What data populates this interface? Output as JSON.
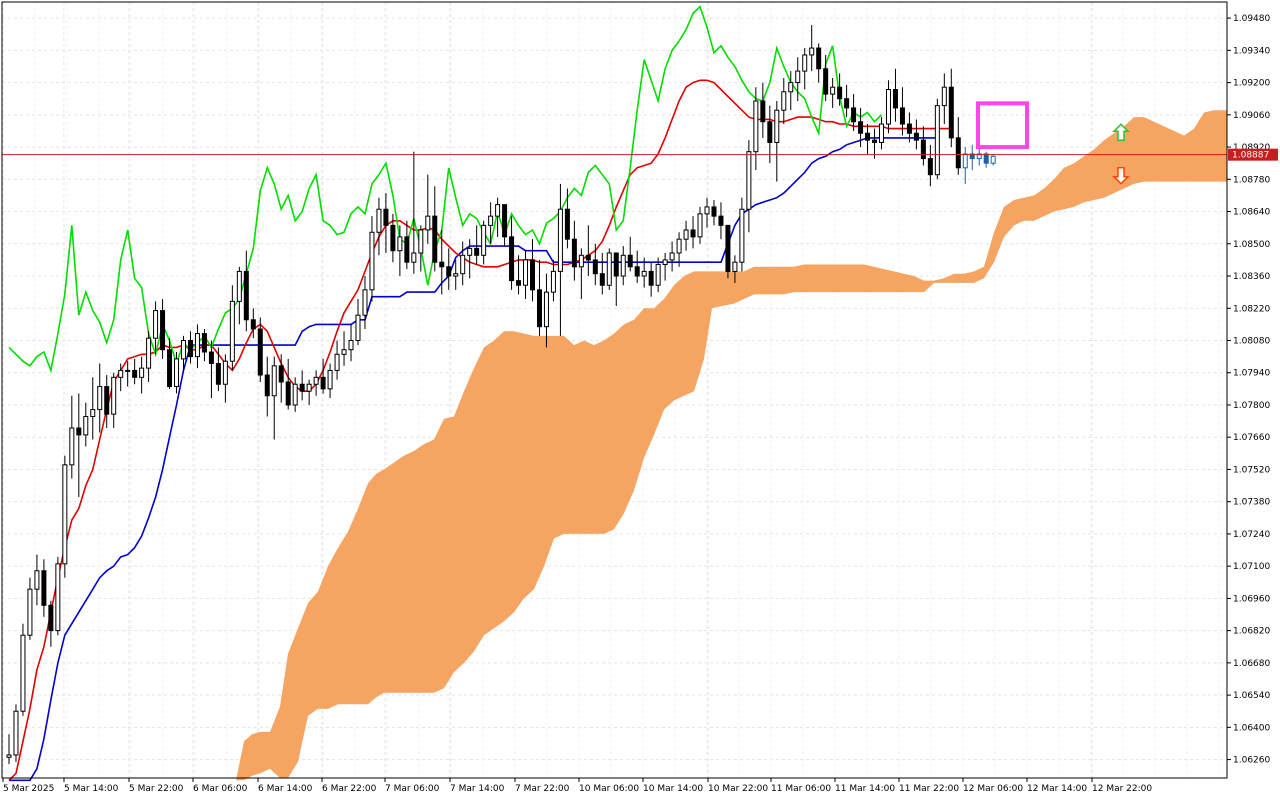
{
  "chart_data": {
    "type": "candlestick",
    "symbol_hint": "EURUSD",
    "y_ticks": [
      "1.09480",
      "1.09340",
      "1.09200",
      "1.09060",
      "1.08920",
      "1.08780",
      "1.08640",
      "1.08500",
      "1.08360",
      "1.08220",
      "1.08080",
      "1.07940",
      "1.07800",
      "1.07660",
      "1.07520",
      "1.07380",
      "1.07240",
      "1.07100",
      "1.06960",
      "1.06820",
      "1.06680",
      "1.06540",
      "1.06400",
      "1.06260"
    ],
    "ylim": [
      1.0618,
      1.0955
    ],
    "x_ticks": [
      "5 Mar 2025",
      "5 Mar 14:00",
      "5 Mar 22:00",
      "6 Mar 06:00",
      "6 Mar 14:00",
      "6 Mar 22:00",
      "7 Mar 06:00",
      "7 Mar 14:00",
      "7 Mar 22:00",
      "10 Mar 06:00",
      "10 Mar 14:00",
      "10 Mar 22:00",
      "11 Mar 06:00",
      "11 Mar 14:00",
      "11 Mar 22:00",
      "12 Mar 06:00",
      "12 Mar 14:00",
      "12 Mar 22:00"
    ],
    "current_price": "1.08887",
    "grid": true,
    "colors": {
      "tenkan": "#e00000",
      "kijun": "#0000cc",
      "chikou": "#00dd00",
      "cloud": "#f5a462",
      "price_line": "#c81e1e",
      "highlight": "#ff44ee",
      "up_arrow": "#33bb33",
      "down_arrow": "#ff4400",
      "last_candles": "#1f5fa8"
    },
    "candles": [
      [
        1.0627,
        1.0637,
        1.0624,
        1.0628
      ],
      [
        1.0628,
        1.065,
        1.0625,
        1.0647
      ],
      [
        1.0647,
        1.0685,
        1.0645,
        1.068
      ],
      [
        1.068,
        1.0705,
        1.0678,
        1.07
      ],
      [
        1.07,
        1.0715,
        1.0693,
        1.0708
      ],
      [
        1.0708,
        1.0713,
        1.0688,
        1.0693
      ],
      [
        1.0693,
        1.0695,
        1.0675,
        1.0682
      ],
      [
        1.0682,
        1.0714,
        1.068,
        1.0711
      ],
      [
        1.0711,
        1.0758,
        1.0705,
        1.0754
      ],
      [
        1.0754,
        1.0784,
        1.0748,
        1.077
      ],
      [
        1.077,
        1.0785,
        1.074,
        1.0767
      ],
      [
        1.0767,
        1.0781,
        1.0762,
        1.0775
      ],
      [
        1.0775,
        1.0792,
        1.0765,
        1.0778
      ],
      [
        1.0778,
        1.0798,
        1.0768,
        1.0788
      ],
      [
        1.0788,
        1.0793,
        1.077,
        1.0776
      ],
      [
        1.0776,
        1.0794,
        1.077,
        1.0792
      ],
      [
        1.0792,
        1.0798,
        1.0786,
        1.0795
      ],
      [
        1.0795,
        1.0799,
        1.0788,
        1.0795
      ],
      [
        1.0795,
        1.08,
        1.0789,
        1.0792
      ],
      [
        1.0792,
        1.0801,
        1.0785,
        1.0796
      ],
      [
        1.0796,
        1.0812,
        1.079,
        1.0809
      ],
      [
        1.0809,
        1.0825,
        1.0802,
        1.0821
      ],
      [
        1.0821,
        1.0826,
        1.08,
        1.0804
      ],
      [
        1.0804,
        1.0809,
        1.0787,
        1.0788
      ],
      [
        1.0788,
        1.0803,
        1.0785,
        1.08
      ],
      [
        1.08,
        1.081,
        1.0795,
        1.0808
      ],
      [
        1.0808,
        1.0812,
        1.0798,
        1.0801
      ],
      [
        1.0801,
        1.0815,
        1.0796,
        1.0811
      ],
      [
        1.0811,
        1.0813,
        1.0799,
        1.0803
      ],
      [
        1.0803,
        1.0808,
        1.0783,
        1.0798
      ],
      [
        1.0798,
        1.0805,
        1.0786,
        1.0789
      ],
      [
        1.0789,
        1.0802,
        1.0781,
        1.0799
      ],
      [
        1.0799,
        1.0832,
        1.0795,
        1.0825
      ],
      [
        1.0825,
        1.084,
        1.0815,
        1.0838
      ],
      [
        1.0838,
        1.0847,
        1.0812,
        1.0817
      ],
      [
        1.0817,
        1.0822,
        1.0809,
        1.0813
      ],
      [
        1.0813,
        1.0818,
        1.079,
        1.0793
      ],
      [
        1.0793,
        1.0801,
        1.0775,
        1.0784
      ],
      [
        1.0784,
        1.0801,
        1.0765,
        1.0797
      ],
      [
        1.0797,
        1.0802,
        1.0781,
        1.079
      ],
      [
        1.079,
        1.08,
        1.0778,
        1.078
      ],
      [
        1.078,
        1.0792,
        1.0777,
        1.0789
      ],
      [
        1.0789,
        1.0795,
        1.0782,
        1.0786
      ],
      [
        1.0786,
        1.0791,
        1.078,
        1.0789
      ],
      [
        1.0789,
        1.0795,
        1.0784,
        1.0792
      ],
      [
        1.0792,
        1.08,
        1.0785,
        1.0787
      ],
      [
        1.0787,
        1.0798,
        1.0783,
        1.0795
      ],
      [
        1.0795,
        1.0808,
        1.0791,
        1.0802
      ],
      [
        1.0802,
        1.0812,
        1.0797,
        1.0804
      ],
      [
        1.0804,
        1.0815,
        1.0799,
        1.0808
      ],
      [
        1.0808,
        1.0826,
        1.0806,
        1.0819
      ],
      [
        1.0819,
        1.0836,
        1.0813,
        1.083
      ],
      [
        1.083,
        1.0862,
        1.0825,
        1.0855
      ],
      [
        1.0855,
        1.087,
        1.0845,
        1.0865
      ],
      [
        1.0865,
        1.0872,
        1.0846,
        1.0858
      ],
      [
        1.0858,
        1.0863,
        1.0842,
        1.0847
      ],
      [
        1.0847,
        1.0858,
        1.0836,
        1.0853
      ],
      [
        1.0853,
        1.086,
        1.0839,
        1.0842
      ],
      [
        1.0842,
        1.089,
        1.0837,
        1.0846
      ],
      [
        1.0846,
        1.0858,
        1.0838,
        1.0856
      ],
      [
        1.0856,
        1.088,
        1.085,
        1.0862
      ],
      [
        1.0862,
        1.0875,
        1.0838,
        1.0842
      ],
      [
        1.0842,
        1.0856,
        1.0828,
        1.084
      ],
      [
        1.084,
        1.0848,
        1.083,
        1.0836
      ],
      [
        1.0836,
        1.0843,
        1.083,
        1.0837
      ],
      [
        1.0837,
        1.0851,
        1.0832,
        1.0845
      ],
      [
        1.0845,
        1.0852,
        1.0835,
        1.0848
      ],
      [
        1.0848,
        1.0858,
        1.0841,
        1.0845
      ],
      [
        1.0845,
        1.086,
        1.0841,
        1.0858
      ],
      [
        1.0858,
        1.0868,
        1.085,
        1.0862
      ],
      [
        1.0862,
        1.087,
        1.0853,
        1.0867
      ],
      [
        1.0867,
        1.0866,
        1.0849,
        1.0853
      ],
      [
        1.0853,
        1.0862,
        1.083,
        1.0834
      ],
      [
        1.0834,
        1.0845,
        1.0828,
        1.0832
      ],
      [
        1.0832,
        1.0847,
        1.0826,
        1.0843
      ],
      [
        1.0843,
        1.0852,
        1.0825,
        1.083
      ],
      [
        1.083,
        1.0843,
        1.081,
        1.0814
      ],
      [
        1.0814,
        1.0837,
        1.0805,
        1.0829
      ],
      [
        1.0829,
        1.0843,
        1.0825,
        1.0838
      ],
      [
        1.0838,
        1.0876,
        1.081,
        1.0865
      ],
      [
        1.0865,
        1.0874,
        1.0848,
        1.0852
      ],
      [
        1.0852,
        1.086,
        1.0834,
        1.084
      ],
      [
        1.084,
        1.0848,
        1.0826,
        1.0845
      ],
      [
        1.0845,
        1.0858,
        1.0836,
        1.0843
      ],
      [
        1.0843,
        1.085,
        1.0832,
        1.0837
      ],
      [
        1.0837,
        1.0846,
        1.0828,
        1.0832
      ],
      [
        1.0832,
        1.0848,
        1.083,
        1.0846
      ],
      [
        1.0846,
        1.0842,
        1.0823,
        1.0836
      ],
      [
        1.0836,
        1.0849,
        1.0832,
        1.0845
      ],
      [
        1.0845,
        1.0853,
        1.0838,
        1.084
      ],
      [
        1.084,
        1.0847,
        1.0833,
        1.0836
      ],
      [
        1.0836,
        1.0844,
        1.0831,
        1.0838
      ],
      [
        1.0838,
        1.0842,
        1.0827,
        1.0832
      ],
      [
        1.0832,
        1.0844,
        1.0829,
        1.0841
      ],
      [
        1.0841,
        1.0846,
        1.0834,
        1.0843
      ],
      [
        1.0843,
        1.0851,
        1.0838,
        1.0846
      ],
      [
        1.0846,
        1.0855,
        1.084,
        1.0852
      ],
      [
        1.0852,
        1.086,
        1.0847,
        1.0856
      ],
      [
        1.0856,
        1.0862,
        1.0848,
        1.0853
      ],
      [
        1.0853,
        1.0866,
        1.085,
        1.0863
      ],
      [
        1.0863,
        1.087,
        1.0857,
        1.0866
      ],
      [
        1.0866,
        1.0869,
        1.0858,
        1.0862
      ],
      [
        1.0862,
        1.0868,
        1.0852,
        1.0858
      ],
      [
        1.0858,
        1.0855,
        1.0835,
        1.0838
      ],
      [
        1.0838,
        1.0845,
        1.0833,
        1.0842
      ],
      [
        1.0842,
        1.087,
        1.0838,
        1.0865
      ],
      [
        1.0865,
        1.0895,
        1.0855,
        1.089
      ],
      [
        1.089,
        1.0918,
        1.0882,
        1.0912
      ],
      [
        1.0912,
        1.092,
        1.0896,
        1.0903
      ],
      [
        1.0903,
        1.091,
        1.0885,
        1.0894
      ],
      [
        1.0894,
        1.0912,
        1.0877,
        1.0908
      ],
      [
        1.0908,
        1.0922,
        1.0902,
        1.0916
      ],
      [
        1.0916,
        1.0925,
        1.0908,
        1.092
      ],
      [
        1.092,
        1.0931,
        1.0912,
        1.0925
      ],
      [
        1.0925,
        1.0935,
        1.0917,
        1.0932
      ],
      [
        1.0932,
        1.0945,
        1.0925,
        1.0935
      ],
      [
        1.0935,
        1.0937,
        1.092,
        1.0926
      ],
      [
        1.0926,
        1.0932,
        1.0912,
        1.0915
      ],
      [
        1.0915,
        1.0922,
        1.0909,
        1.0918
      ],
      [
        1.0918,
        1.0924,
        1.091,
        1.0913
      ],
      [
        1.0913,
        1.0919,
        1.0905,
        1.0909
      ],
      [
        1.0909,
        1.0915,
        1.0899,
        1.0903
      ],
      [
        1.0903,
        1.0909,
        1.0892,
        1.0898
      ],
      [
        1.0898,
        1.0902,
        1.0889,
        1.0895
      ],
      [
        1.0895,
        1.09,
        1.0887,
        1.0894
      ],
      [
        1.0894,
        1.0905,
        1.0891,
        1.0902
      ],
      [
        1.0902,
        1.0921,
        1.0898,
        1.0917
      ],
      [
        1.0917,
        1.0926,
        1.0903,
        1.0909
      ],
      [
        1.0909,
        1.0918,
        1.0897,
        1.0902
      ],
      [
        1.0902,
        1.0907,
        1.0894,
        1.0898
      ],
      [
        1.0898,
        1.0904,
        1.0891,
        1.0895
      ],
      [
        1.0895,
        1.0901,
        1.0884,
        1.0887
      ],
      [
        1.0887,
        1.0893,
        1.0875,
        1.088
      ],
      [
        1.088,
        1.0913,
        1.0878,
        1.091
      ],
      [
        1.091,
        1.0924,
        1.0902,
        1.0918
      ],
      [
        1.0918,
        1.0926,
        1.0892,
        1.0896
      ],
      [
        1.0896,
        1.0905,
        1.088,
        1.0883
      ],
      [
        1.0883,
        1.0892,
        1.0876,
        1.0889
      ],
      [
        1.0889,
        1.0893,
        1.0882,
        1.0887
      ],
      [
        1.0887,
        1.0893,
        1.0884,
        1.0889
      ],
      [
        1.0889,
        1.089,
        1.0883,
        1.0885
      ],
      [
        1.0885,
        1.0889,
        1.0884,
        1.0888
      ]
    ],
    "tenkan": [
      1.0617,
      1.062,
      1.0634,
      1.0648,
      1.0665,
      1.0675,
      1.069,
      1.0705,
      1.0718,
      1.073,
      1.0735,
      1.0745,
      1.0752,
      1.0765,
      1.0778,
      1.079,
      1.0795,
      1.08,
      1.0801,
      1.0802,
      1.0802,
      1.0803,
      1.0806,
      1.0805,
      1.0805,
      1.0806,
      1.0804,
      1.0804,
      1.0806,
      1.0806,
      1.0802,
      1.0798,
      1.0795,
      1.08,
      1.0807,
      1.0813,
      1.0815,
      1.0812,
      1.0805,
      1.0798,
      1.0792,
      1.0788,
      1.0786,
      1.0786,
      1.0789,
      1.0795,
      1.0803,
      1.0812,
      1.082,
      1.0825,
      1.083,
      1.0838,
      1.0846,
      1.0853,
      1.0858,
      1.086,
      1.086,
      1.0858,
      1.0856,
      1.0856,
      1.0857,
      1.0856,
      1.0852,
      1.0849,
      1.0846,
      1.0844,
      1.0842,
      1.0841,
      1.084,
      1.084,
      1.084,
      1.0841,
      1.0842,
      1.0843,
      1.0843,
      1.0843,
      1.0842,
      1.0842,
      1.0841,
      1.0841,
      1.0841,
      1.0842,
      1.0843,
      1.0845,
      1.0847,
      1.0851,
      1.0858,
      1.0866,
      1.0873,
      1.088,
      1.0883,
      1.0884,
      1.0885,
      1.0889,
      1.0896,
      1.0904,
      1.0912,
      1.0918,
      1.092,
      1.0921,
      1.0921,
      1.092,
      1.0917,
      1.0914,
      1.0911,
      1.0908,
      1.0905,
      1.0904,
      1.0904,
      1.0904,
      1.0903,
      1.0903,
      1.0904,
      1.0905,
      1.0905,
      1.0905,
      1.0904,
      1.0903,
      1.0903,
      1.0902,
      1.0902,
      1.0901,
      1.0901,
      1.0901,
      1.0901,
      1.0901,
      1.09,
      1.09,
      1.09,
      1.09,
      1.09,
      1.09,
      1.09,
      1.09,
      1.09,
      1.09
    ],
    "kijun": [
      1.0617,
      1.0617,
      1.0617,
      1.0617,
      1.0622,
      1.0635,
      1.0652,
      1.0668,
      1.068,
      1.0685,
      1.069,
      1.0695,
      1.07,
      1.0705,
      1.0708,
      1.071,
      1.0714,
      1.0715,
      1.0718,
      1.0723,
      1.0731,
      1.074,
      1.0752,
      1.0766,
      1.078,
      1.0795,
      1.0806,
      1.0806,
      1.0806,
      1.0806,
      1.0806,
      1.0806,
      1.0806,
      1.0806,
      1.0806,
      1.0806,
      1.0806,
      1.0806,
      1.0806,
      1.0806,
      1.0806,
      1.0806,
      1.0812,
      1.0814,
      1.0815,
      1.0815,
      1.0815,
      1.0815,
      1.0815,
      1.0815,
      1.0817,
      1.0817,
      1.0827,
      1.0827,
      1.0827,
      1.0827,
      1.0827,
      1.0829,
      1.0829,
      1.0829,
      1.0829,
      1.0829,
      1.0833,
      1.0836,
      1.0844,
      1.0847,
      1.0849,
      1.0849,
      1.0849,
      1.0849,
      1.0849,
      1.0849,
      1.0849,
      1.0849,
      1.0847,
      1.0847,
      1.0847,
      1.0847,
      1.0842,
      1.0842,
      1.0842,
      1.0842,
      1.0842,
      1.0842,
      1.0842,
      1.0842,
      1.0842,
      1.0842,
      1.0842,
      1.0842,
      1.0842,
      1.0842,
      1.0842,
      1.0842,
      1.0842,
      1.0842,
      1.0842,
      1.0842,
      1.0842,
      1.0842,
      1.0842,
      1.0842,
      1.0842,
      1.085,
      1.0858,
      1.0863,
      1.0865,
      1.0867,
      1.0868,
      1.0869,
      1.087,
      1.0872,
      1.0875,
      1.0878,
      1.0881,
      1.0885,
      1.0887,
      1.0888,
      1.089,
      1.0891,
      1.0893,
      1.0894,
      1.0895,
      1.0896,
      1.0896,
      1.0896,
      1.0896,
      1.0896,
      1.0896,
      1.0896,
      1.0896,
      1.0896,
      1.0896,
      1.0896
    ],
    "chikou_ref": "chikou plots closes shifted 26 periods left"
  }
}
